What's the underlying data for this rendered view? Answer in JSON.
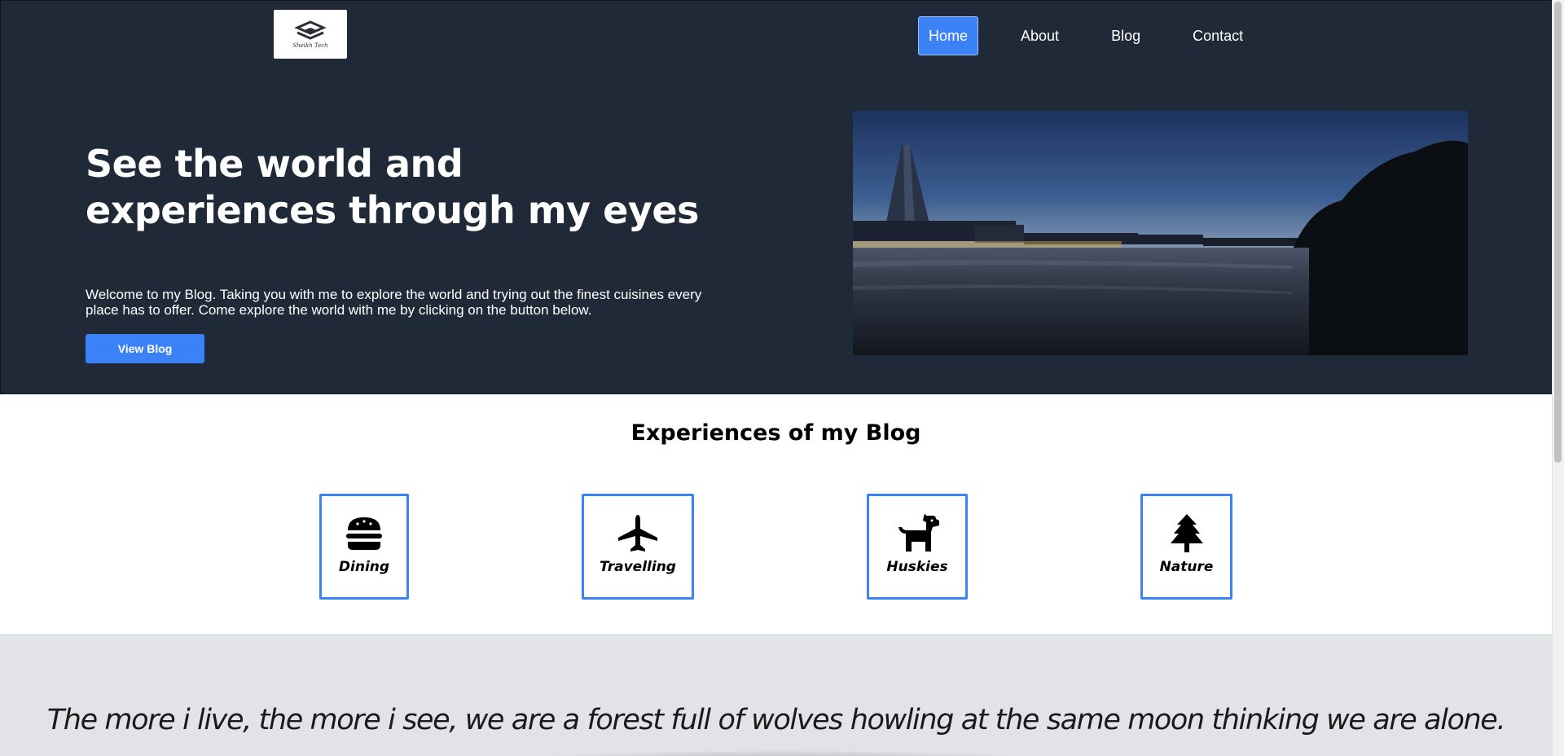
{
  "logo": {
    "alt_text": "Sheikh Tech"
  },
  "nav": {
    "items": [
      {
        "label": "Home",
        "active": true
      },
      {
        "label": "About",
        "active": false
      },
      {
        "label": "Blog",
        "active": false
      },
      {
        "label": "Contact",
        "active": false
      }
    ]
  },
  "hero": {
    "title": "See the world and experiences through my eyes",
    "description": "Welcome to my Blog. Taking you with me to explore the world and trying out the finest cuisines every place has to offer. Come explore the world with me by clicking on the button below.",
    "button_label": "View Blog",
    "image_icon": "city-river-sunset-photo"
  },
  "experiences": {
    "title": "Experiences of my Blog",
    "cards": [
      {
        "label": "Dining",
        "icon": "burger-icon"
      },
      {
        "label": "Travelling",
        "icon": "plane-icon"
      },
      {
        "label": "Huskies",
        "icon": "dog-icon"
      },
      {
        "label": "Nature",
        "icon": "tree-icon"
      }
    ]
  },
  "quote": {
    "text": "The more i live, the more i see, we are a forest full of wolves howling at the same moon thinking we are alone."
  },
  "colors": {
    "hero_bg": "#1f2937",
    "accent": "#3b82f6",
    "quote_bg": "#e2e3e7"
  }
}
